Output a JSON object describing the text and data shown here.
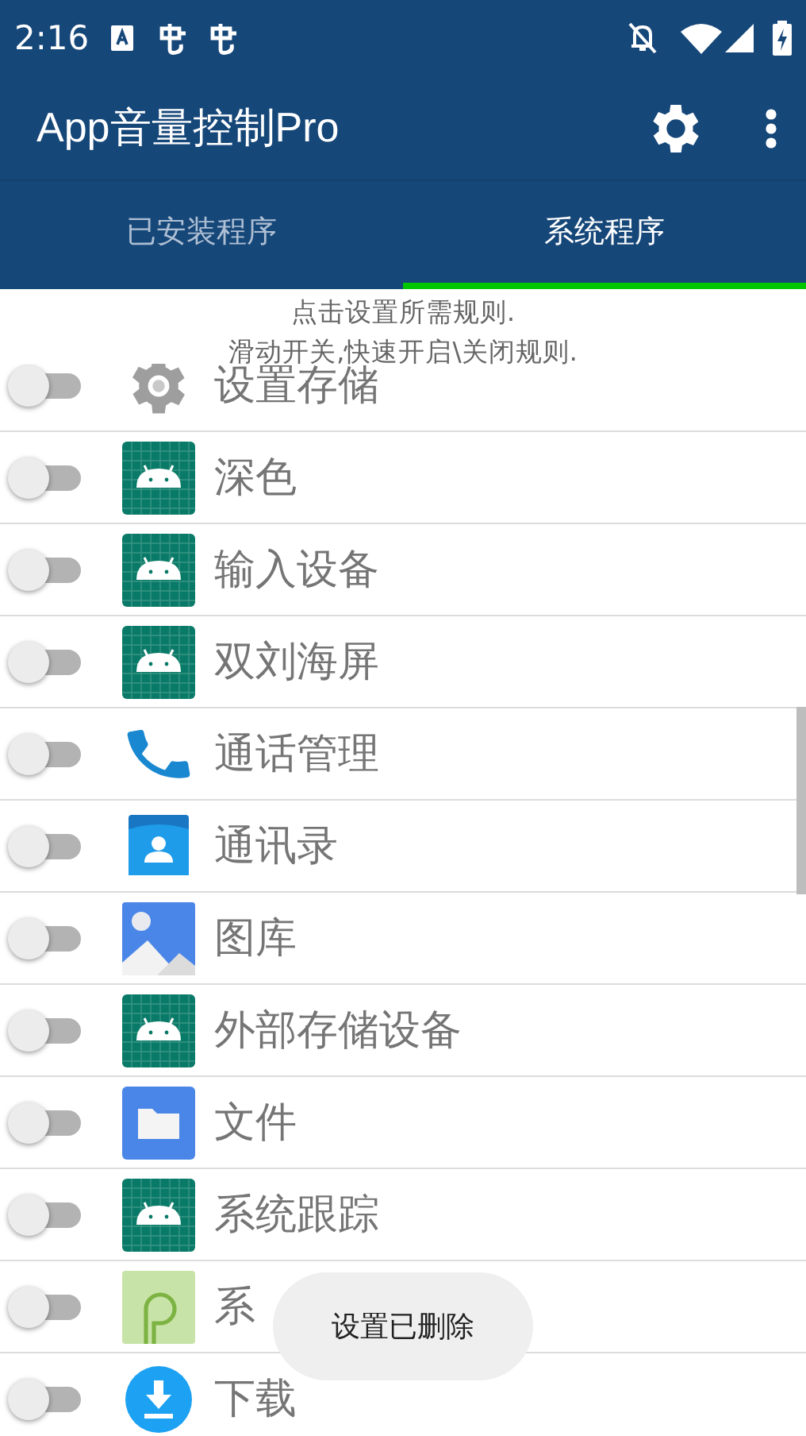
{
  "status_bar": {
    "time": "2:16"
  },
  "app_bar": {
    "title": "App音量控制Pro"
  },
  "tabs": [
    {
      "label": "已安装程序",
      "selected": false
    },
    {
      "label": "系统程序",
      "selected": true
    }
  ],
  "hint": [
    "点击设置所需规则.",
    "滑动开关,快速开启\\关闭规则."
  ],
  "apps": [
    {
      "name": "设置存储",
      "kind": "gear",
      "on": false
    },
    {
      "name": "深色",
      "kind": "android",
      "on": false
    },
    {
      "name": "输入设备",
      "kind": "android",
      "on": false
    },
    {
      "name": "双刘海屏",
      "kind": "android",
      "on": false
    },
    {
      "name": "通话管理",
      "kind": "phone",
      "on": false
    },
    {
      "name": "通讯录",
      "kind": "contacts",
      "on": false
    },
    {
      "name": "图库",
      "kind": "gallery",
      "on": false
    },
    {
      "name": "外部存储设备",
      "kind": "android",
      "on": false
    },
    {
      "name": "文件",
      "kind": "folder",
      "on": false
    },
    {
      "name": "系统跟踪",
      "kind": "android",
      "on": false
    },
    {
      "name": "系",
      "kind": "pie",
      "on": false
    },
    {
      "name": "下载",
      "kind": "download",
      "on": false
    }
  ],
  "toast": {
    "text": "设置已删除"
  }
}
